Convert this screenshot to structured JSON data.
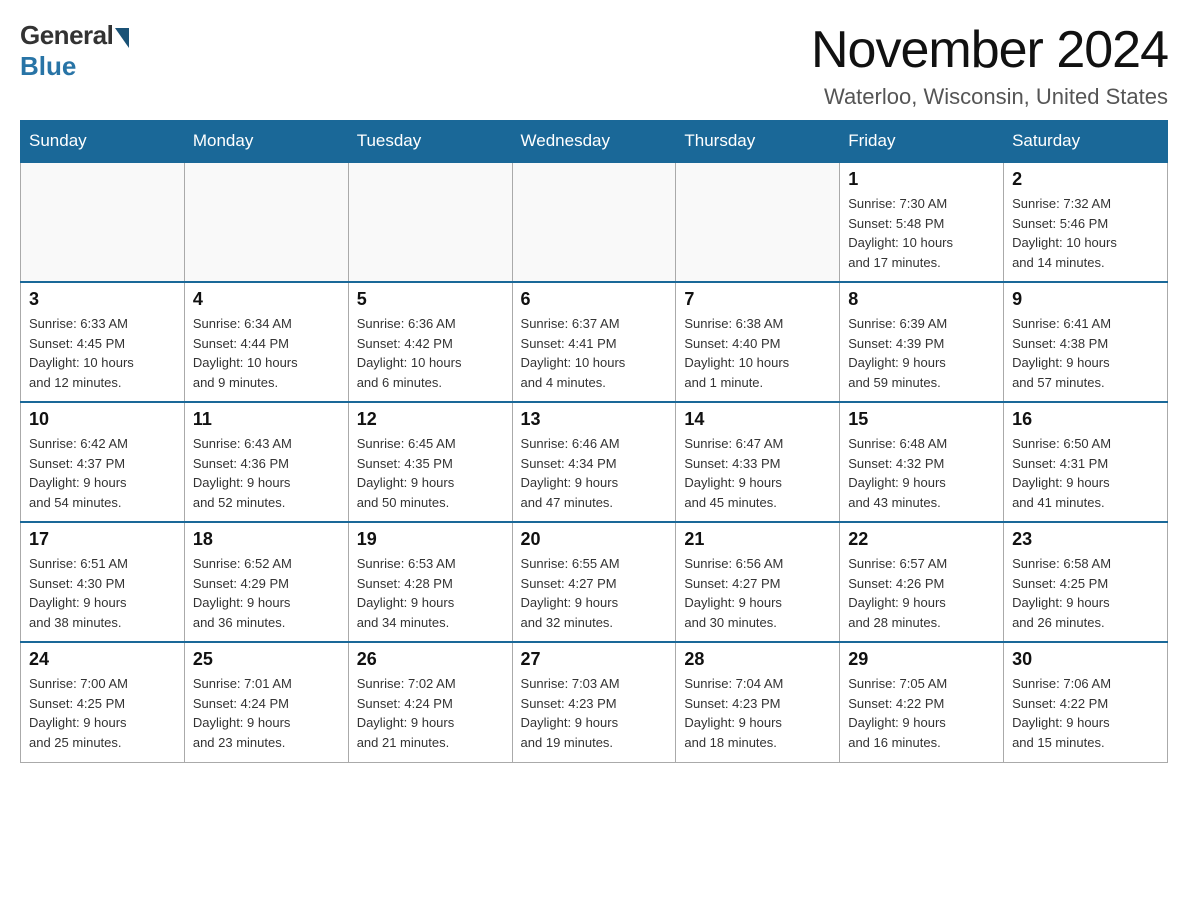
{
  "logo": {
    "general": "General",
    "blue": "Blue"
  },
  "title": "November 2024",
  "location": "Waterloo, Wisconsin, United States",
  "days_of_week": [
    "Sunday",
    "Monday",
    "Tuesday",
    "Wednesday",
    "Thursday",
    "Friday",
    "Saturday"
  ],
  "weeks": [
    [
      {
        "day": "",
        "info": ""
      },
      {
        "day": "",
        "info": ""
      },
      {
        "day": "",
        "info": ""
      },
      {
        "day": "",
        "info": ""
      },
      {
        "day": "",
        "info": ""
      },
      {
        "day": "1",
        "info": "Sunrise: 7:30 AM\nSunset: 5:48 PM\nDaylight: 10 hours\nand 17 minutes."
      },
      {
        "day": "2",
        "info": "Sunrise: 7:32 AM\nSunset: 5:46 PM\nDaylight: 10 hours\nand 14 minutes."
      }
    ],
    [
      {
        "day": "3",
        "info": "Sunrise: 6:33 AM\nSunset: 4:45 PM\nDaylight: 10 hours\nand 12 minutes."
      },
      {
        "day": "4",
        "info": "Sunrise: 6:34 AM\nSunset: 4:44 PM\nDaylight: 10 hours\nand 9 minutes."
      },
      {
        "day": "5",
        "info": "Sunrise: 6:36 AM\nSunset: 4:42 PM\nDaylight: 10 hours\nand 6 minutes."
      },
      {
        "day": "6",
        "info": "Sunrise: 6:37 AM\nSunset: 4:41 PM\nDaylight: 10 hours\nand 4 minutes."
      },
      {
        "day": "7",
        "info": "Sunrise: 6:38 AM\nSunset: 4:40 PM\nDaylight: 10 hours\nand 1 minute."
      },
      {
        "day": "8",
        "info": "Sunrise: 6:39 AM\nSunset: 4:39 PM\nDaylight: 9 hours\nand 59 minutes."
      },
      {
        "day": "9",
        "info": "Sunrise: 6:41 AM\nSunset: 4:38 PM\nDaylight: 9 hours\nand 57 minutes."
      }
    ],
    [
      {
        "day": "10",
        "info": "Sunrise: 6:42 AM\nSunset: 4:37 PM\nDaylight: 9 hours\nand 54 minutes."
      },
      {
        "day": "11",
        "info": "Sunrise: 6:43 AM\nSunset: 4:36 PM\nDaylight: 9 hours\nand 52 minutes."
      },
      {
        "day": "12",
        "info": "Sunrise: 6:45 AM\nSunset: 4:35 PM\nDaylight: 9 hours\nand 50 minutes."
      },
      {
        "day": "13",
        "info": "Sunrise: 6:46 AM\nSunset: 4:34 PM\nDaylight: 9 hours\nand 47 minutes."
      },
      {
        "day": "14",
        "info": "Sunrise: 6:47 AM\nSunset: 4:33 PM\nDaylight: 9 hours\nand 45 minutes."
      },
      {
        "day": "15",
        "info": "Sunrise: 6:48 AM\nSunset: 4:32 PM\nDaylight: 9 hours\nand 43 minutes."
      },
      {
        "day": "16",
        "info": "Sunrise: 6:50 AM\nSunset: 4:31 PM\nDaylight: 9 hours\nand 41 minutes."
      }
    ],
    [
      {
        "day": "17",
        "info": "Sunrise: 6:51 AM\nSunset: 4:30 PM\nDaylight: 9 hours\nand 38 minutes."
      },
      {
        "day": "18",
        "info": "Sunrise: 6:52 AM\nSunset: 4:29 PM\nDaylight: 9 hours\nand 36 minutes."
      },
      {
        "day": "19",
        "info": "Sunrise: 6:53 AM\nSunset: 4:28 PM\nDaylight: 9 hours\nand 34 minutes."
      },
      {
        "day": "20",
        "info": "Sunrise: 6:55 AM\nSunset: 4:27 PM\nDaylight: 9 hours\nand 32 minutes."
      },
      {
        "day": "21",
        "info": "Sunrise: 6:56 AM\nSunset: 4:27 PM\nDaylight: 9 hours\nand 30 minutes."
      },
      {
        "day": "22",
        "info": "Sunrise: 6:57 AM\nSunset: 4:26 PM\nDaylight: 9 hours\nand 28 minutes."
      },
      {
        "day": "23",
        "info": "Sunrise: 6:58 AM\nSunset: 4:25 PM\nDaylight: 9 hours\nand 26 minutes."
      }
    ],
    [
      {
        "day": "24",
        "info": "Sunrise: 7:00 AM\nSunset: 4:25 PM\nDaylight: 9 hours\nand 25 minutes."
      },
      {
        "day": "25",
        "info": "Sunrise: 7:01 AM\nSunset: 4:24 PM\nDaylight: 9 hours\nand 23 minutes."
      },
      {
        "day": "26",
        "info": "Sunrise: 7:02 AM\nSunset: 4:24 PM\nDaylight: 9 hours\nand 21 minutes."
      },
      {
        "day": "27",
        "info": "Sunrise: 7:03 AM\nSunset: 4:23 PM\nDaylight: 9 hours\nand 19 minutes."
      },
      {
        "day": "28",
        "info": "Sunrise: 7:04 AM\nSunset: 4:23 PM\nDaylight: 9 hours\nand 18 minutes."
      },
      {
        "day": "29",
        "info": "Sunrise: 7:05 AM\nSunset: 4:22 PM\nDaylight: 9 hours\nand 16 minutes."
      },
      {
        "day": "30",
        "info": "Sunrise: 7:06 AM\nSunset: 4:22 PM\nDaylight: 9 hours\nand 15 minutes."
      }
    ]
  ]
}
